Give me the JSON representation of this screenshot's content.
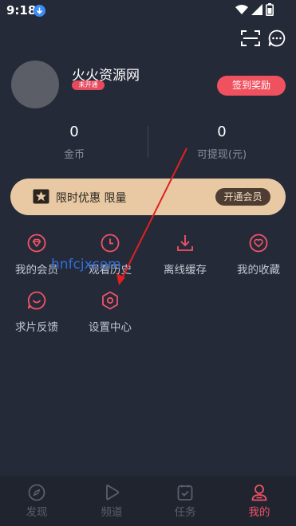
{
  "status_bar": {
    "time": "9:18"
  },
  "profile": {
    "username": "火火资源网",
    "vip_status": "未开通",
    "checkin_label": "签到奖励"
  },
  "stats": [
    {
      "value": "0",
      "label": "金币"
    },
    {
      "value": "0",
      "label": "可提现(元)"
    }
  ],
  "vip_banner": {
    "text": "限时优惠 限量",
    "button": "开通会员"
  },
  "menu": [
    {
      "label": "我的会员",
      "icon": "diamond-icon"
    },
    {
      "label": "观看历史",
      "icon": "clock-icon"
    },
    {
      "label": "离线缓存",
      "icon": "download-icon"
    },
    {
      "label": "我的收藏",
      "icon": "heart-icon"
    },
    {
      "label": "求片反馈",
      "icon": "smile-chat-icon"
    },
    {
      "label": "设置中心",
      "icon": "settings-hexagon-icon"
    }
  ],
  "watermark": "hnfcjxcom",
  "bottom_nav": [
    {
      "label": "发现",
      "icon": "compass-icon"
    },
    {
      "label": "频道",
      "icon": "play-icon"
    },
    {
      "label": "任务",
      "icon": "task-check-icon"
    },
    {
      "label": "我的",
      "icon": "user-icon",
      "active": true
    }
  ],
  "colors": {
    "background": "#252a39",
    "accent": "#f0515f",
    "vip_gold": "#e8c9a3",
    "annotation_arrow": "#e02020"
  }
}
